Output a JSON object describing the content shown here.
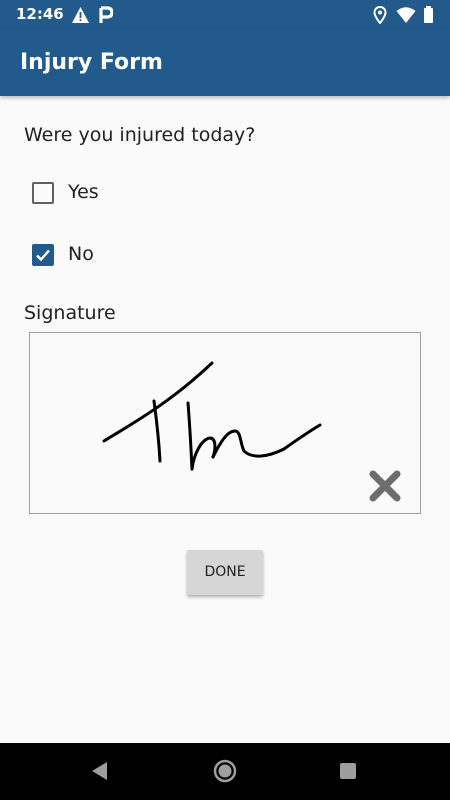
{
  "status_bar": {
    "time": "12:46",
    "left_icons": [
      "alert-icon",
      "p-icon"
    ],
    "right_icons": [
      "location-icon",
      "wifi-icon",
      "battery-icon"
    ]
  },
  "app_bar": {
    "title": "Injury Form"
  },
  "form": {
    "question": "Were you injured today?",
    "options": [
      {
        "label": "Yes",
        "checked": false
      },
      {
        "label": "No",
        "checked": true
      }
    ],
    "signature_label": "Signature",
    "signature_text": "Thu"
  },
  "done_button": {
    "label": "DONE"
  },
  "nav_bar": {
    "icons": [
      "back-icon",
      "home-icon",
      "recents-icon"
    ]
  },
  "colors": {
    "primary": "#235a8c",
    "background": "#fafafa",
    "button": "#d6d6d6"
  }
}
